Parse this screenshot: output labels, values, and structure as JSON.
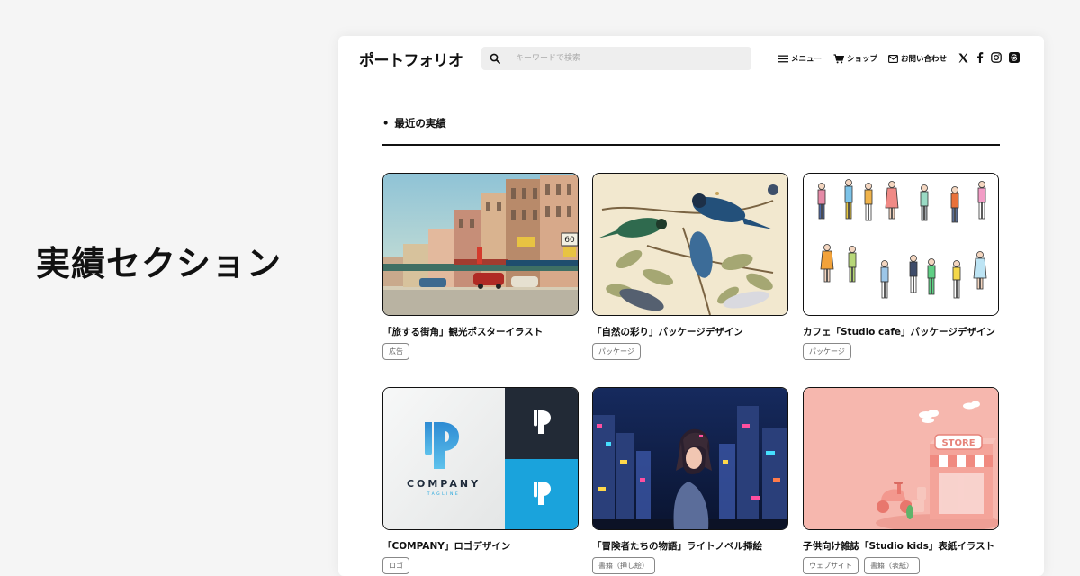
{
  "side_heading": "実績セクション",
  "header": {
    "logo": "ポートフォリオ",
    "search_placeholder": "キーワードで検索",
    "nav": {
      "menu": "メニュー",
      "shop": "ショップ",
      "contact": "お問い合わせ"
    }
  },
  "section": {
    "bullet": "•",
    "title": "最近の実績"
  },
  "works": [
    {
      "title": "「旅する街角」観光ポスターイラスト",
      "tags": [
        "広告"
      ]
    },
    {
      "title": "「自然の彩り」パッケージデザイン",
      "tags": [
        "パッケージ"
      ]
    },
    {
      "title": "カフェ「Studio cafe」パッケージデザイン",
      "tags": [
        "パッケージ"
      ]
    },
    {
      "title": "「COMPANY」ロゴデザイン",
      "tags": [
        "ロゴ"
      ]
    },
    {
      "title": "「冒険者たちの物語」ライトノベル挿絵",
      "tags": [
        "書籍（挿し絵）"
      ]
    },
    {
      "title": "子供向け雑誌「Studio kids」表紙イラスト",
      "tags": [
        "ウェブサイト",
        "書籍（表紙）"
      ]
    }
  ],
  "thumb_text": {
    "logo_word": "COMPANY",
    "logo_tagline": "TAGLINE",
    "store_sign": "STORE",
    "poster_sign": "60"
  },
  "colors": {
    "accent_blue": "#1aa3dc",
    "dark_navy": "#222a36",
    "pink_bg": "#f6b7ae"
  }
}
